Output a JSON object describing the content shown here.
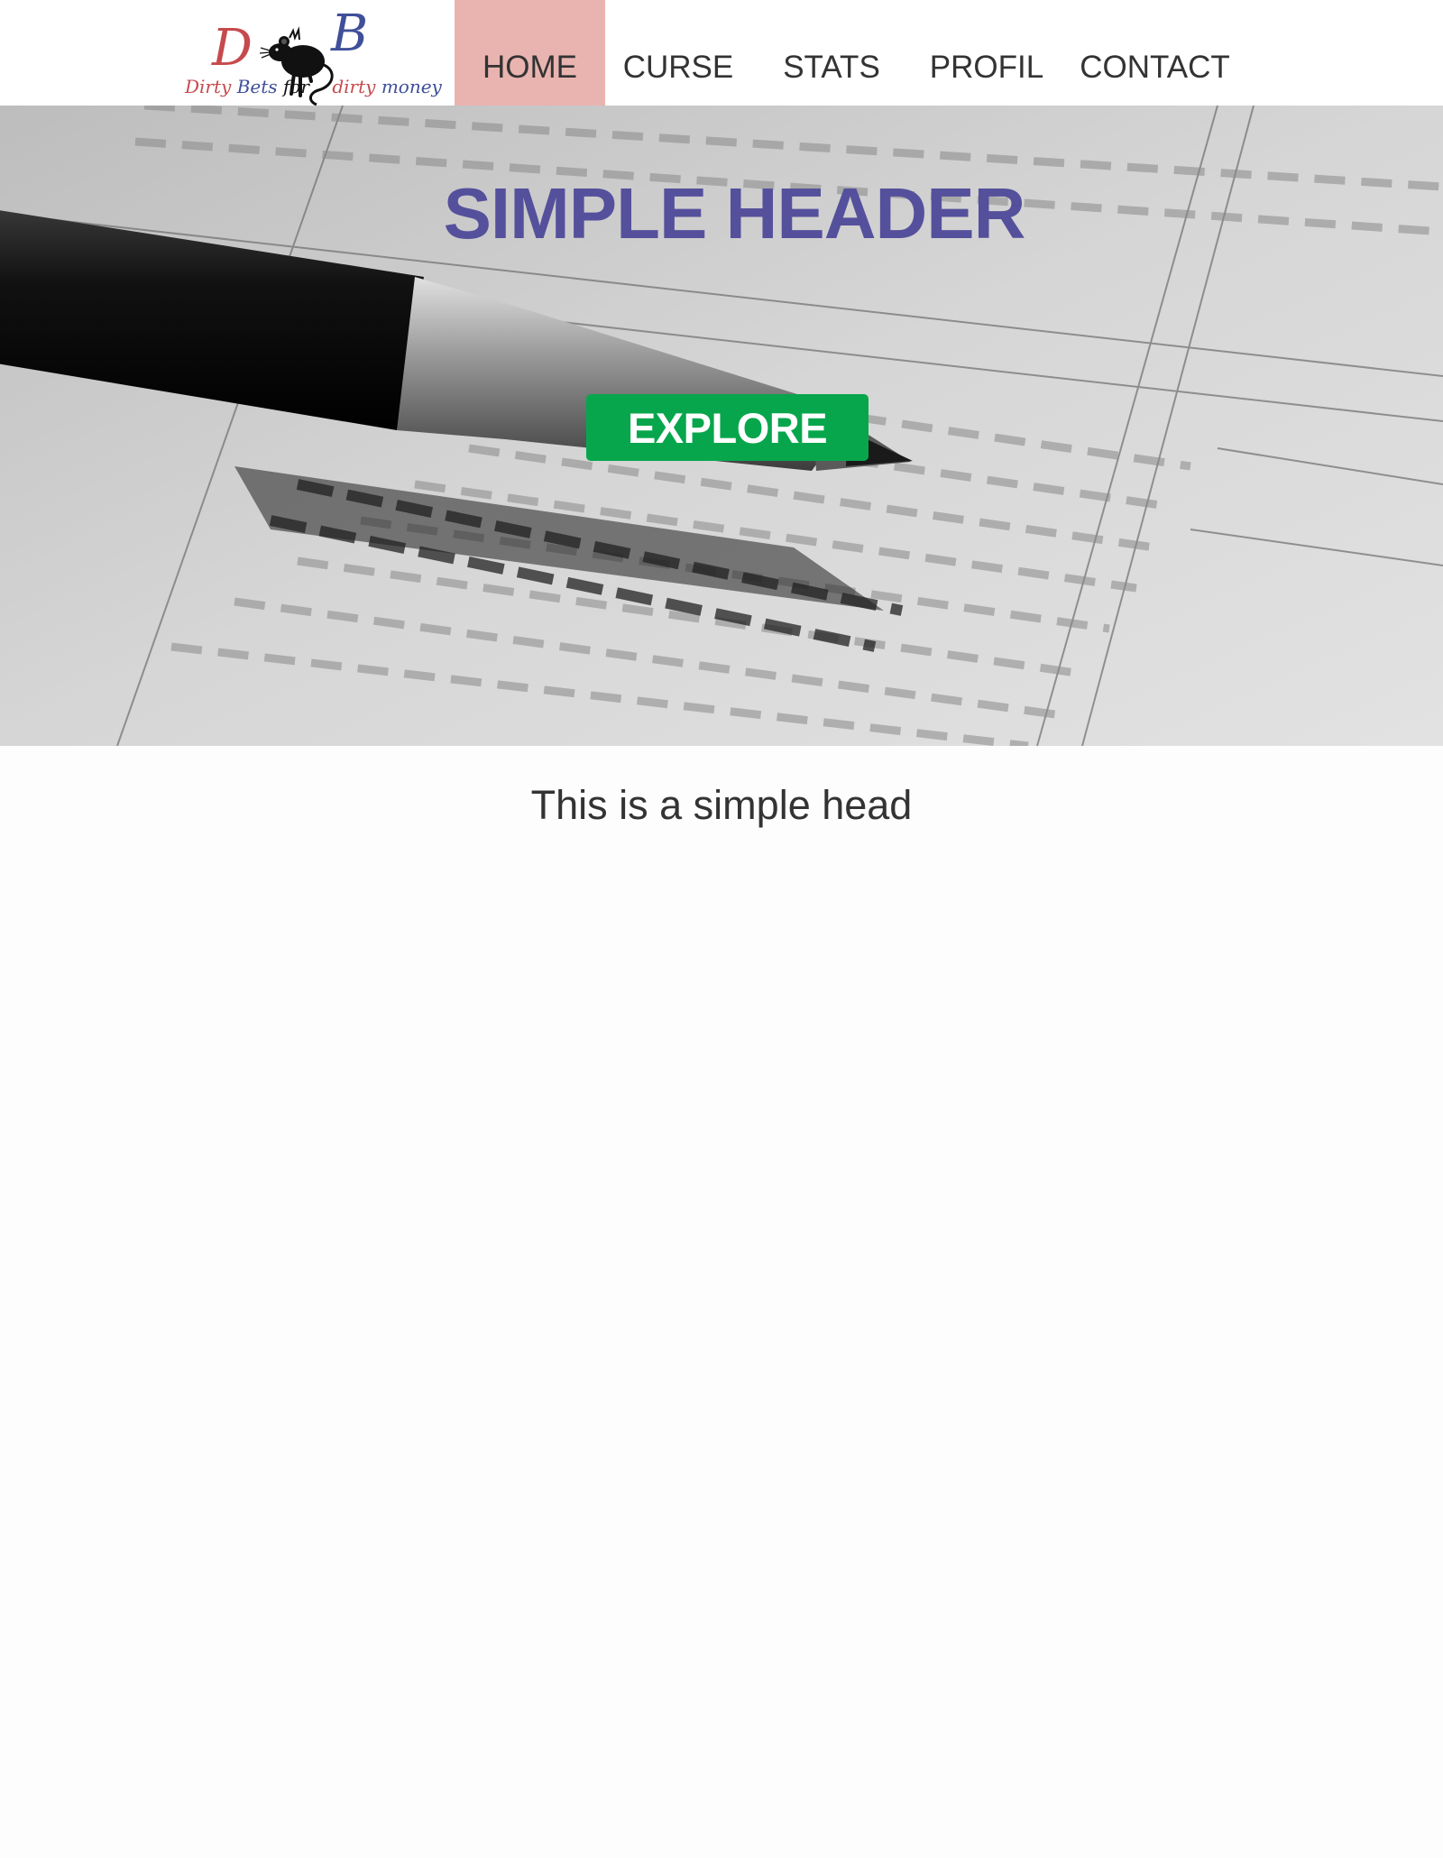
{
  "logo": {
    "letters": [
      "D",
      "B"
    ],
    "tagline": [
      "Dirty",
      "Bets",
      "for",
      "dirty",
      "money"
    ],
    "icon": "rat-icon"
  },
  "nav": {
    "items": [
      {
        "label": "HOME",
        "active": true
      },
      {
        "label": "CURSE",
        "active": false
      },
      {
        "label": "STATS",
        "active": false
      },
      {
        "label": "PROFIL",
        "active": false
      },
      {
        "label": "CONTACT",
        "active": false
      }
    ]
  },
  "hero": {
    "title": "SIMPLE HEADER",
    "button_label": "EXPLORE"
  },
  "content": {
    "lead": "This is a simple head"
  },
  "colors": {
    "nav_active": "#e9b4b0",
    "title": "#55509c",
    "button": "#08a64c",
    "logo_red": "#c64a4d",
    "logo_blue": "#3f4f9a"
  }
}
